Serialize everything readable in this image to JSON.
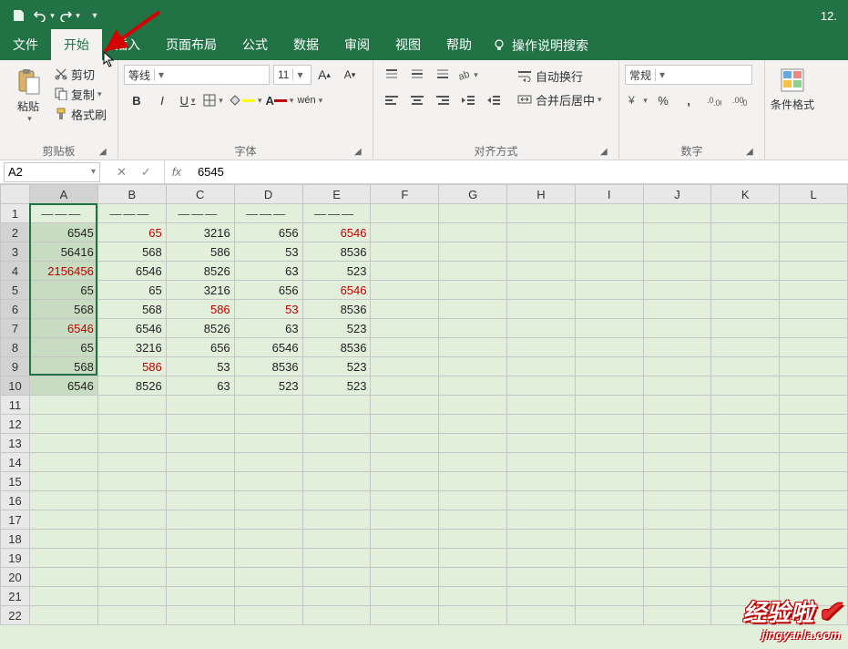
{
  "qat": {
    "title_right": "12."
  },
  "menu": {
    "file": "文件",
    "home": "开始",
    "insert": "插入",
    "pagelayout": "页面布局",
    "formulas": "公式",
    "data": "数据",
    "review": "审阅",
    "view": "视图",
    "help": "帮助",
    "tellme": "操作说明搜索"
  },
  "ribbon": {
    "clipboard": {
      "paste": "粘贴",
      "cut": "剪切",
      "copy": "复制",
      "formatpainter": "格式刷",
      "label": "剪贴板"
    },
    "font": {
      "name": "等线",
      "size": "11",
      "label": "字体"
    },
    "alignment": {
      "wrap": "自动换行",
      "merge": "合并后居中",
      "label": "对齐方式"
    },
    "number": {
      "format": "常规",
      "label": "数字"
    },
    "styles": {
      "cond": "条件格式"
    }
  },
  "formula_bar": {
    "cellref": "A2",
    "value": "6545"
  },
  "columns": [
    "A",
    "B",
    "C",
    "D",
    "E",
    "F",
    "G",
    "H",
    "I",
    "J",
    "K",
    "L"
  ],
  "rows_count": 22,
  "headers_row": [
    "———",
    "———",
    "———",
    "———",
    "———"
  ],
  "data_rows": [
    [
      {
        "v": "6545"
      },
      {
        "v": "65",
        "red": true
      },
      {
        "v": "3216"
      },
      {
        "v": "656"
      },
      {
        "v": "6546",
        "red": true
      }
    ],
    [
      {
        "v": "56416"
      },
      {
        "v": "568"
      },
      {
        "v": "586"
      },
      {
        "v": "53"
      },
      {
        "v": "8536"
      }
    ],
    [
      {
        "v": "2156456",
        "red": true
      },
      {
        "v": "6546"
      },
      {
        "v": "8526"
      },
      {
        "v": "63"
      },
      {
        "v": "523"
      }
    ],
    [
      {
        "v": "65"
      },
      {
        "v": "65"
      },
      {
        "v": "3216"
      },
      {
        "v": "656"
      },
      {
        "v": "6546",
        "red": true
      }
    ],
    [
      {
        "v": "568"
      },
      {
        "v": "568"
      },
      {
        "v": "586",
        "red": true
      },
      {
        "v": "53",
        "red": true
      },
      {
        "v": "8536"
      }
    ],
    [
      {
        "v": "6546",
        "red": true
      },
      {
        "v": "6546"
      },
      {
        "v": "8526"
      },
      {
        "v": "63"
      },
      {
        "v": "523"
      }
    ],
    [
      {
        "v": "65"
      },
      {
        "v": "3216"
      },
      {
        "v": "656"
      },
      {
        "v": "6546"
      },
      {
        "v": "8536"
      }
    ],
    [
      {
        "v": "568"
      },
      {
        "v": "586",
        "red": true
      },
      {
        "v": "53"
      },
      {
        "v": "8536"
      },
      {
        "v": "523"
      }
    ],
    [
      {
        "v": "6546"
      },
      {
        "v": "8526"
      },
      {
        "v": "63"
      },
      {
        "v": "523"
      },
      {
        "v": "523"
      }
    ]
  ],
  "watermark": {
    "line1": "经验啦",
    "line2": "jingyanla.com"
  },
  "chart_data": {
    "type": "table",
    "title": "",
    "columns": [
      "A",
      "B",
      "C",
      "D",
      "E"
    ],
    "rows": [
      [
        6545,
        65,
        3216,
        656,
        6546
      ],
      [
        56416,
        568,
        586,
        53,
        8536
      ],
      [
        2156456,
        6546,
        8526,
        63,
        523
      ],
      [
        65,
        65,
        3216,
        656,
        6546
      ],
      [
        568,
        568,
        586,
        53,
        8536
      ],
      [
        6546,
        6546,
        8526,
        63,
        523
      ],
      [
        65,
        3216,
        656,
        6546,
        8536
      ],
      [
        568,
        586,
        53,
        8536,
        523
      ],
      [
        6546,
        8526,
        63,
        523,
        523
      ]
    ]
  }
}
